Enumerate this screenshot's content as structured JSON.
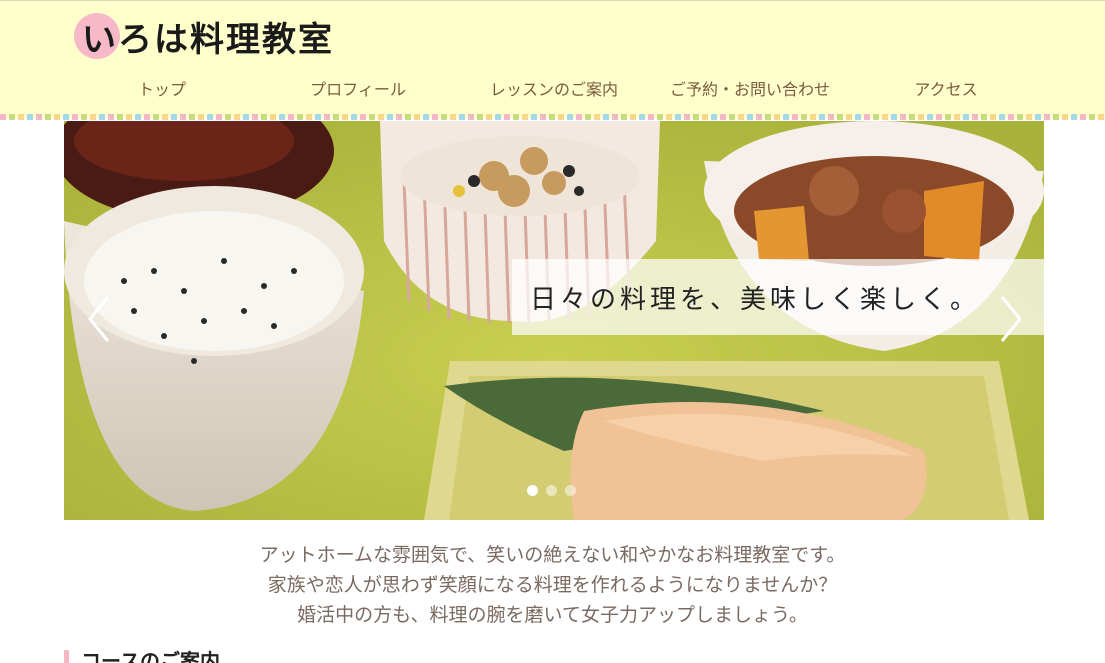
{
  "logo": {
    "text": "いろは料理教室"
  },
  "nav": {
    "items": [
      {
        "label": "トップ"
      },
      {
        "label": "プロフィール"
      },
      {
        "label": "レッスンのご案内"
      },
      {
        "label": "ご予約・お問い合わせ"
      },
      {
        "label": "アクセス"
      }
    ]
  },
  "hero": {
    "caption": "日々の料理を、美味しく楽しく。",
    "slide_count": 3,
    "active_slide": 1
  },
  "intro": {
    "lines": [
      "アットホームな雰囲気で、笑いの絶えない和やかなお料理教室です。",
      "家族や恋人が思わず笑顔になる料理を作れるようになりませんか？",
      "婚活中の方も、料理の腕を磨いて女子力アップしましょう。"
    ]
  },
  "section": {
    "title": "コースのご案内"
  },
  "colors": {
    "header_bg": "#ffffcc",
    "accent_pink": "#f7b8c8",
    "nav_text": "#7a5a40"
  }
}
